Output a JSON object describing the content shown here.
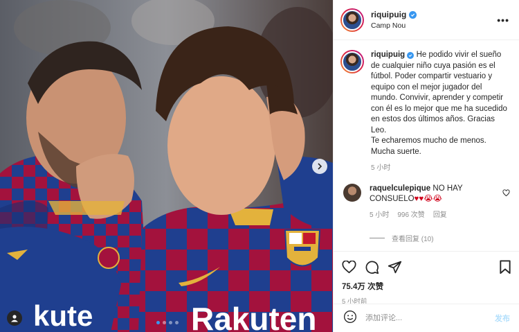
{
  "post": {
    "username": "riquipuig",
    "location": "Camp Nou",
    "caption_lines": [
      "He podido vivir el sueño",
      "de cualquier niño cuya pasión es el",
      "fútbol. Poder compartir vestuario y",
      "equipo con el mejor jugador del",
      "mundo. Convivir, aprender y competir",
      "con él es lo mejor que me ha sucedido",
      "en estos dos últimos años. Gracias",
      "Leo.",
      "Te echaremos mucho de menos.",
      "Mucha suerte."
    ],
    "caption_time": "5 小时",
    "likes": "75.4万 次赞",
    "posted_ago": "5 小时前"
  },
  "comment": {
    "username": "raquelculepique",
    "text": "NO HAY",
    "text2": "CONSUELO",
    "emoji": "♥♥😭😭",
    "time": "5 小时",
    "likes": "996 次赞",
    "reply": "回复",
    "view_replies": "查看回复 (10)"
  },
  "add_comment": {
    "placeholder": "添加评论...",
    "post_label": "发布"
  },
  "photo": {
    "sponsor_text": "Rakuten",
    "sponsor_text_left": "kute"
  },
  "icons": {
    "header_more": "more-icon",
    "like": "heart-icon",
    "comment": "comment-icon",
    "share": "share-icon",
    "save": "bookmark-icon",
    "emoji": "emoji-icon"
  },
  "colors": {
    "verified": "#3897f0",
    "post_button": "#b2dffc",
    "heart": "#d0021b",
    "barca_blue": "#1f3f8f",
    "barca_red": "#a3123d"
  }
}
